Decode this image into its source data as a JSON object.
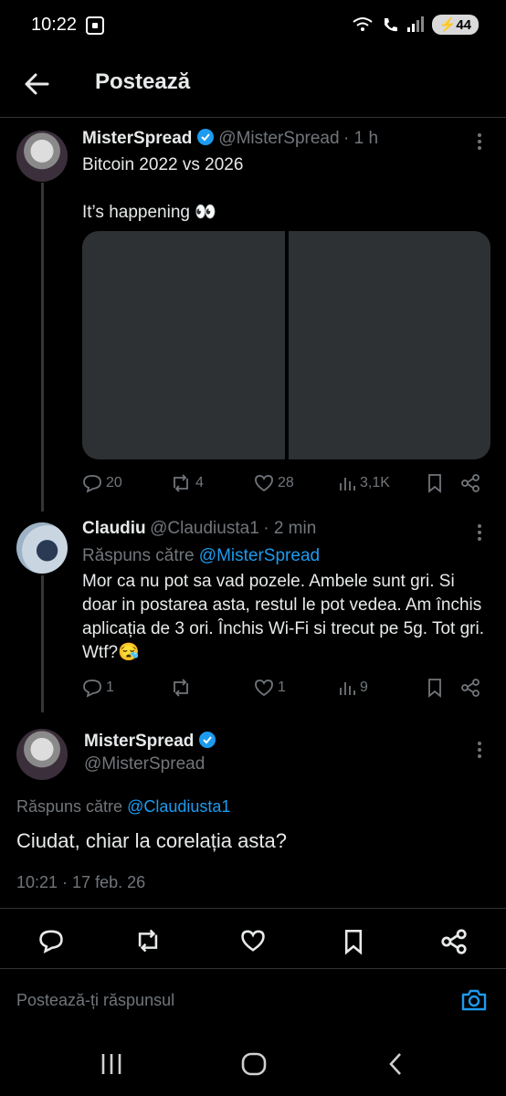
{
  "status": {
    "time": "10:22",
    "battery": "44"
  },
  "header": {
    "title": "Postează"
  },
  "tweet1": {
    "name": "MisterSpread",
    "handle": "@MisterSpread",
    "time": "· 1 h",
    "line1": "Bitcoin 2022 vs 2026",
    "line2": "It’s happening 👀",
    "replies": "20",
    "reposts": "4",
    "likes": "28",
    "views": "3,1K"
  },
  "tweet2": {
    "name": "Claudiu",
    "handle": "@Claudiusta1",
    "time": "· 2 min",
    "reply_prefix": "Răspuns către",
    "reply_to": "@MisterSpread",
    "text": "Mor ca nu pot sa vad pozele. Ambele sunt gri. Si doar in postarea asta, restul le pot vedea. Am închis aplicația de 3 ori. Închis Wi-Fi si trecut pe 5g. Tot gri. Wtf?😪",
    "replies": "1",
    "reposts": "",
    "likes": "1",
    "views": "9"
  },
  "tweet3": {
    "name": "MisterSpread",
    "handle": "@MisterSpread",
    "reply_prefix": "Răspuns către",
    "reply_to": "@Claudiusta1",
    "text": "Ciudat, chiar la corelația asta?",
    "timestamp": "10:21 · 17 feb. 26"
  },
  "composer": {
    "placeholder": "Postează-ți răspunsul"
  },
  "colors": {
    "accent": "#1d9bf0",
    "bg": "#000000",
    "muted": "#71767b"
  }
}
